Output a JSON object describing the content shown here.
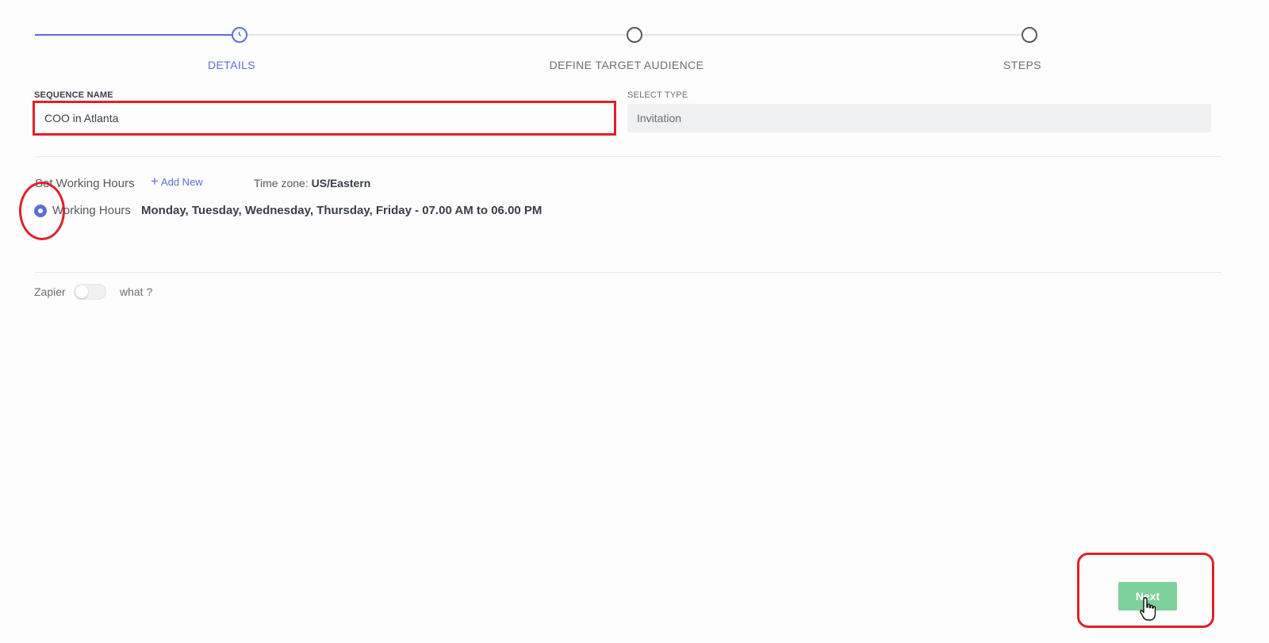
{
  "stepper": {
    "steps": [
      {
        "label": "DETAILS",
        "state": "active"
      },
      {
        "label": "DEFINE TARGET AUDIENCE",
        "state": "pending"
      },
      {
        "label": "STEPS",
        "state": "pending"
      }
    ]
  },
  "form": {
    "sequence_name_label": "SEQUENCE NAME",
    "sequence_name_value": "COO in Atlanta",
    "select_type_label": "SELECT TYPE",
    "select_type_value": "Invitation"
  },
  "working_hours": {
    "title": "Set Working Hours",
    "add_new_icon": "+",
    "add_new_label": "Add New",
    "timezone_label": "Time zone:",
    "timezone_value": "US/Eastern",
    "option_name": "Working Hours",
    "option_description": "Monday, Tuesday, Wednesday, Thursday, Friday - 07.00 AM to 06.00 PM",
    "selected": true
  },
  "zapier": {
    "label": "Zapier",
    "enabled": false,
    "help_label": "what ?"
  },
  "footer": {
    "next_label": "Next"
  },
  "colors": {
    "accent": "#5b6fd6",
    "next_button": "#7ed19a",
    "annotation": "#e0202a"
  }
}
